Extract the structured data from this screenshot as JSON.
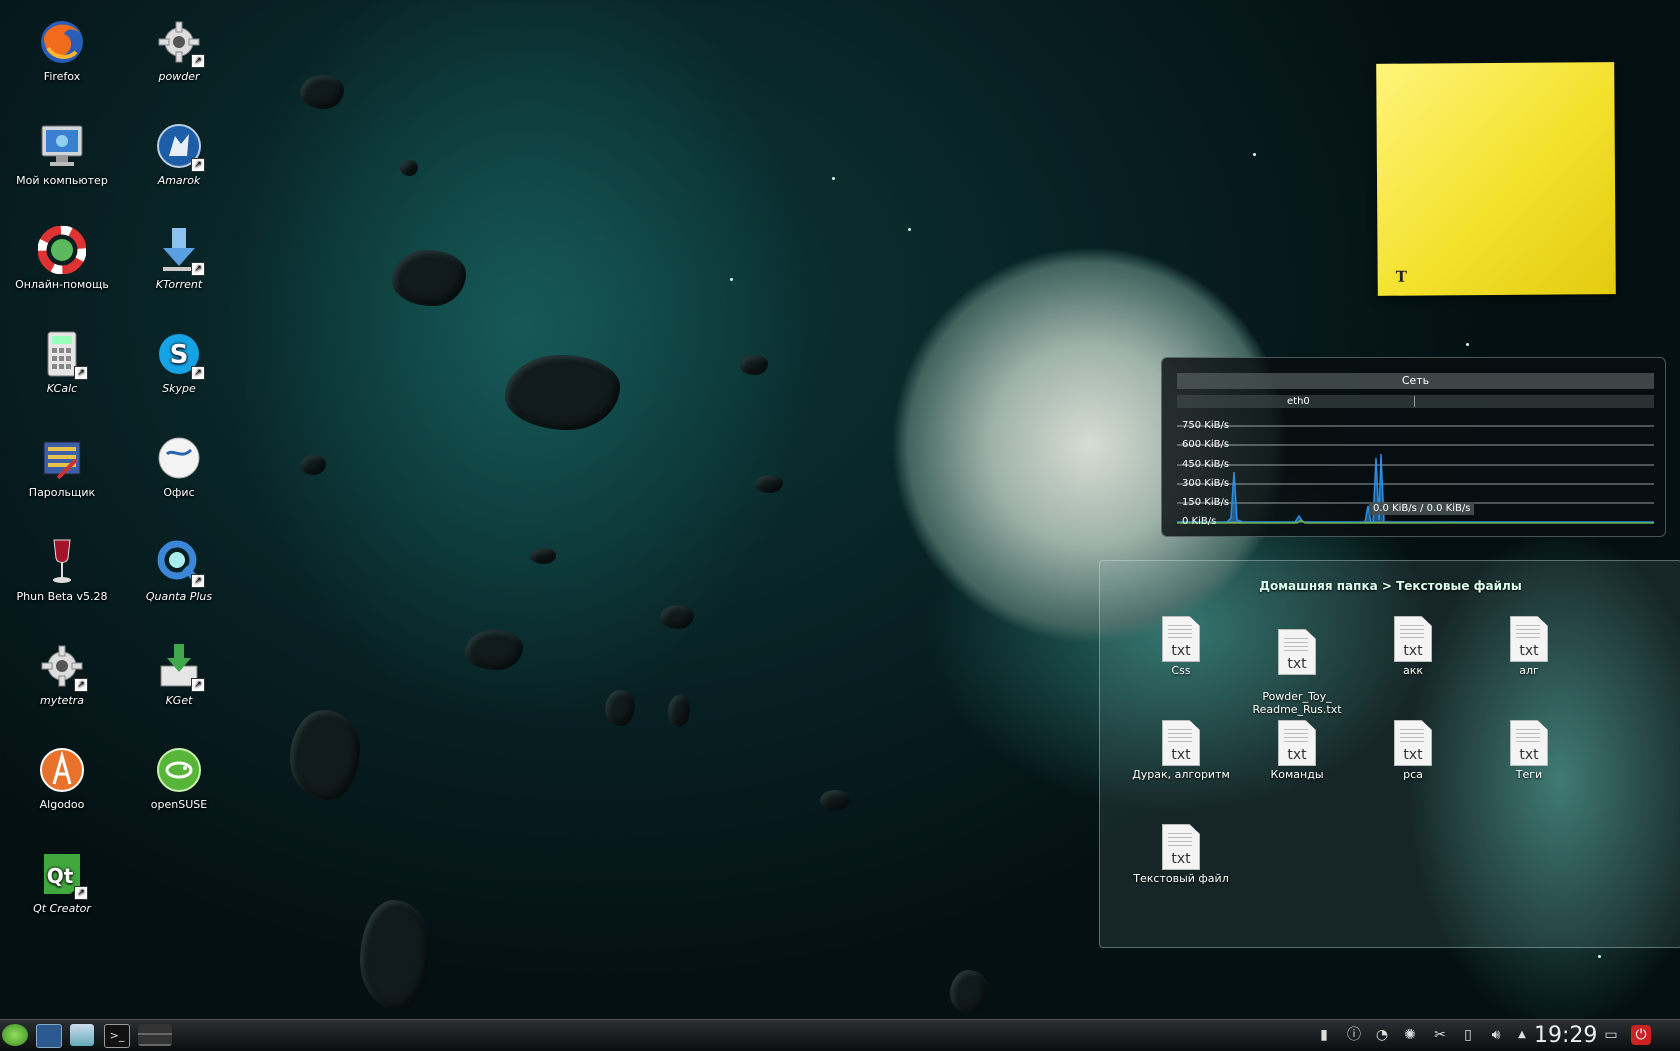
{
  "desktop_icons": [
    {
      "label": "Firefox",
      "icon": "firefox-icon"
    },
    {
      "label": "powder",
      "icon": "gear-icon"
    },
    {
      "label": "Мой компьютер",
      "icon": "monitor-icon"
    },
    {
      "label": "Amarok",
      "icon": "amarok-icon"
    },
    {
      "label": "Онлайн-помощь",
      "icon": "lifebuoy-icon"
    },
    {
      "label": "KTorrent",
      "icon": "download-arrow-icon"
    },
    {
      "label": "KCalc",
      "icon": "calculator-icon"
    },
    {
      "label": "Skype",
      "icon": "skype-icon"
    },
    {
      "label": "Парольщик",
      "icon": "password-manager-icon"
    },
    {
      "label": "Офис",
      "icon": "office-icon"
    },
    {
      "label": "Phun Beta v5.28",
      "icon": "wine-glass-icon"
    },
    {
      "label": "Quanta Plus",
      "icon": "quanta-icon"
    },
    {
      "label": "mytetra",
      "icon": "gear-icon"
    },
    {
      "label": "KGet",
      "icon": "kget-icon"
    },
    {
      "label": "Algodoo",
      "icon": "algodoo-icon"
    },
    {
      "label": "openSUSE",
      "icon": "opensuse-icon"
    },
    {
      "label": "Qt Creator",
      "icon": "qt-icon"
    }
  ],
  "network_widget": {
    "title": "Сеть",
    "interface": "eth0",
    "y_labels": [
      "750 KiB/s",
      "600 KiB/s",
      "450 KiB/s",
      "300 KiB/s",
      "150 KiB/s",
      "0 KiB/s"
    ],
    "readout": "0.0 KiB/s / 0.0 KiB/s",
    "colors": {
      "download": "#2e8fe0",
      "upload": "#6ab04c",
      "grid": "#cfd8d8"
    }
  },
  "folder_view": {
    "path": "Домашняя папка > Текстовые файлы",
    "file_badge": "txt",
    "files": [
      {
        "name": "Css"
      },
      {
        "name": "Powder_Toy_\nReadme_Rus.txt"
      },
      {
        "name": "акк"
      },
      {
        "name": "алг"
      },
      {
        "name": "Дурак, алгоритм"
      },
      {
        "name": "Команды"
      },
      {
        "name": "рса"
      },
      {
        "name": "Теги"
      },
      {
        "name": "Текстовый файл"
      }
    ]
  },
  "sticky_note": {
    "tool_icon": "text-tool-icon",
    "color": "#f3e12c"
  },
  "taskbar": {
    "launchers": [
      "kickoff-menu-icon",
      "desktop-icon",
      "file-manager-icon",
      "terminal-icon",
      "pager-icon"
    ],
    "tray": [
      "clipboard-icon",
      "info-icon",
      "network-icon",
      "settings-icon",
      "scissors-icon",
      "battery-icon",
      "volume-icon",
      "expand-arrow-icon"
    ],
    "clock": "19:29",
    "end_icons": [
      "lock-icon",
      "power-icon"
    ]
  }
}
